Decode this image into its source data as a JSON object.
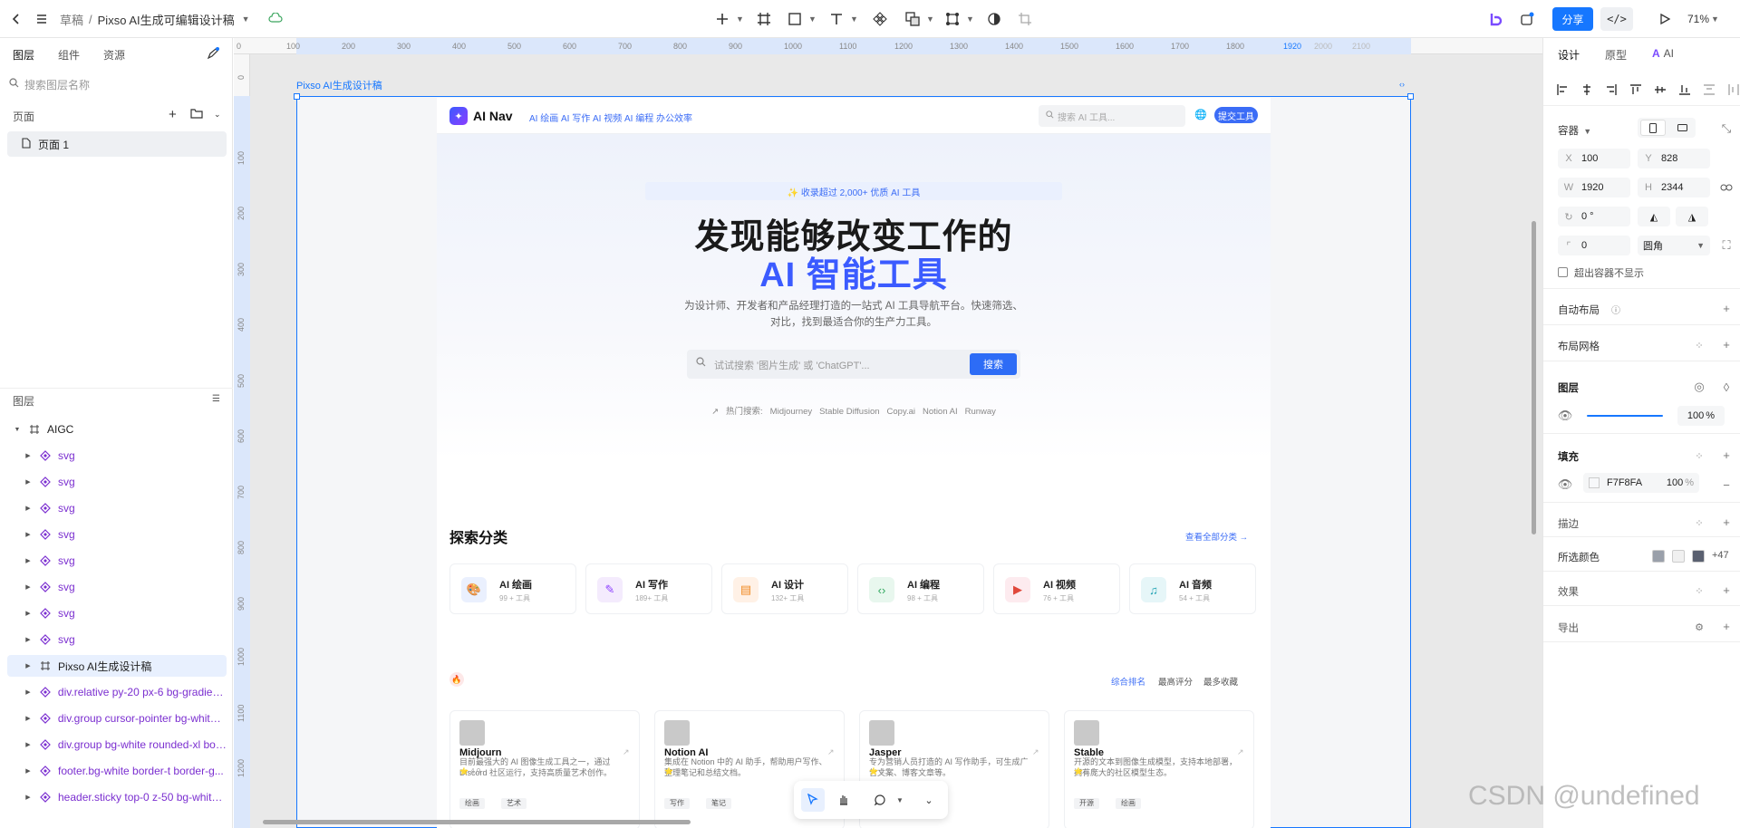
{
  "topbar": {
    "breadcrumb_root": "草稿",
    "separator": "/",
    "file_title": "Pixso AI生成可编辑设计稿",
    "share_label": "分享",
    "code_label": "</>",
    "zoom": "71%"
  },
  "left": {
    "tabs": [
      "图层",
      "组件",
      "资源"
    ],
    "search_placeholder": "搜索图层名称",
    "pages_label": "页面",
    "page_item": "页面 1",
    "layers_label": "图层",
    "layers": [
      {
        "label": "AIGC",
        "type": "frame"
      },
      {
        "label": "svg",
        "type": "comp"
      },
      {
        "label": "svg",
        "type": "comp"
      },
      {
        "label": "svg",
        "type": "comp"
      },
      {
        "label": "svg",
        "type": "comp"
      },
      {
        "label": "svg",
        "type": "comp"
      },
      {
        "label": "svg",
        "type": "comp"
      },
      {
        "label": "svg",
        "type": "comp"
      },
      {
        "label": "svg",
        "type": "comp"
      },
      {
        "label": "Pixso AI生成设计稿",
        "type": "frame"
      },
      {
        "label": "div.relative py-20 px-6 bg-gradien...",
        "type": "comp"
      },
      {
        "label": "div.group cursor-pointer bg-white ...",
        "type": "comp"
      },
      {
        "label": "div.group bg-white rounded-xl bor...",
        "type": "comp"
      },
      {
        "label": "footer.bg-white border-t border-g...",
        "type": "comp"
      },
      {
        "label": "header.sticky top-0 z-50 bg-white...",
        "type": "comp"
      }
    ]
  },
  "ruler": {
    "h_ticks": [
      "0",
      "100",
      "200",
      "300",
      "400",
      "500",
      "600",
      "700",
      "800",
      "900",
      "1000",
      "1100",
      "1200",
      "1300",
      "1400",
      "1500",
      "1600",
      "1700",
      "1800",
      "1920",
      "2000",
      "2100"
    ],
    "v_ticks": [
      "0",
      "100",
      "200",
      "300",
      "400",
      "500",
      "600",
      "700",
      "800",
      "900",
      "1000",
      "1100",
      "1200"
    ]
  },
  "canvas": {
    "frame_label": "Pixso AI生成设计稿"
  },
  "design": {
    "brand": "AI Nav",
    "nav_links": "AI 绘画  AI 写作  AI 视频  AI 编程  办公效率",
    "search_placeholder": "搜索 AI 工具...",
    "submit_label": "提交工具",
    "badge": "✨ 收录超过 2,000+ 优质 AI 工具",
    "headline_1": "发现能够改变工作的",
    "headline_2": "AI 智能工具",
    "subtitle": "为设计师、开发者和产品经理打造的一站式 AI 工具导航平台。快速筛选、对比，找到最适合你的生产力工具。",
    "hero_search_placeholder": "试试搜索 '图片生成' 或 'ChatGPT'...",
    "hero_search_button": "搜索",
    "hot_label": "热门搜索:",
    "hot_terms": [
      "Midjourney",
      "Stable Diffusion",
      "Copy.ai",
      "Notion AI",
      "Runway"
    ],
    "section_title": "探索分类",
    "view_all": "查看全部分类 →",
    "categories": [
      {
        "name": "AI 绘画",
        "count": "99 + 工具",
        "color": "#eaf0fe",
        "icon": "🎨"
      },
      {
        "name": "AI 写作",
        "count": "189+ 工具",
        "color": "#f4ebfd",
        "icon": "✎"
      },
      {
        "name": "AI 设计",
        "count": "132+ 工具",
        "color": "#fff1e6",
        "icon": "▤"
      },
      {
        "name": "AI 编程",
        "count": "98 + 工具",
        "color": "#e8f7ee",
        "icon": "‹›"
      },
      {
        "name": "AI 视频",
        "count": "76 + 工具",
        "color": "#fdebef",
        "icon": "▶"
      },
      {
        "name": "AI 音频",
        "count": "54 + 工具",
        "color": "#e6f6f8",
        "icon": "♫"
      }
    ],
    "sort_tabs": [
      "综合排名",
      "最高评分",
      "最多收藏"
    ],
    "tools": [
      {
        "name": "Midjourn",
        "desc": "目前最强大的 AI 图像生成工具之一，通过 Discord 社区运行，支持高质量艺术创作。",
        "rating": "⭐ 4.9",
        "tags": [
          "绘画",
          "艺术"
        ]
      },
      {
        "name": "Notion AI",
        "desc": "集成在 Notion 中的 AI 助手，帮助用户写作、整理笔记和总结文档。",
        "rating": "⭐ 4.8",
        "tags": [
          "写作",
          "笔记"
        ]
      },
      {
        "name": "Jasper",
        "desc": "专为营销人员打造的 AI 写作助手，可生成广告文案、博客文章等。",
        "rating": "⭐ 4.7",
        "tags": []
      },
      {
        "name": "Stable",
        "desc": "开源的文本到图像生成模型，支持本地部署，拥有庞大的社区模型生态。",
        "rating": "⭐ 4.6",
        "tags": [
          "开源",
          "绘画"
        ]
      }
    ]
  },
  "right": {
    "tabs": [
      "设计",
      "原型",
      "AI"
    ],
    "container_label": "容器",
    "x": "100",
    "y": "828",
    "w": "1920",
    "h": "2344",
    "rotation": "0 °",
    "radius": "0",
    "corner_type": "圆角",
    "clip_label": "超出容器不显示",
    "auto_layout": "自动布局",
    "layout_grid": "布局网格",
    "layer_label": "图层",
    "opacity": "100",
    "opacity_unit": "%",
    "fill_label": "填充",
    "fill_hex": "F7F8FA",
    "fill_opacity": "100",
    "fill_unit": "%",
    "stroke_label": "描边",
    "selected_colors_label": "所选颜色",
    "selected_colors_more": "+47",
    "effects_label": "效果",
    "export_label": "导出"
  },
  "watermark": "CSDN @undefined"
}
